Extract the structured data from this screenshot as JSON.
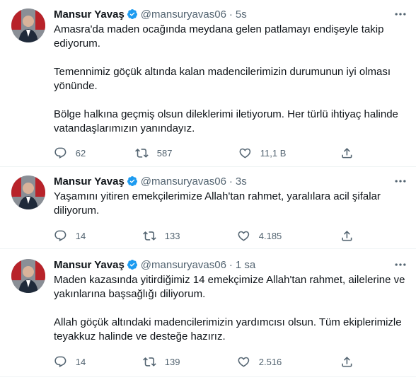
{
  "tweets": [
    {
      "name": "Mansur Yavaş",
      "handle": "@mansuryavas06",
      "dot": "·",
      "time": "5s",
      "paragraphs": [
        "Amasra'da maden ocağında meydana gelen patlamayı endişeyle takip ediyorum.",
        "Temennimiz göçük altında kalan madencilerimizin durumunun iyi olması yönünde.",
        "Bölge halkına geçmiş olsun dileklerimi iletiyorum. Her türlü ihtiyaç halinde vatandaşlarımızın yanındayız."
      ],
      "replies": "62",
      "retweets": "587",
      "likes": "11,1 B"
    },
    {
      "name": "Mansur Yavaş",
      "handle": "@mansuryavas06",
      "dot": "·",
      "time": "3s",
      "paragraphs": [
        "Yaşamını yitiren emekçilerimize Allah'tan rahmet, yaralılara acil şifalar diliyorum."
      ],
      "replies": "14",
      "retweets": "133",
      "likes": "4.185"
    },
    {
      "name": "Mansur Yavaş",
      "handle": "@mansuryavas06",
      "dot": "·",
      "time": "1 sa",
      "paragraphs": [
        "Maden kazasında yitirdiğimiz 14 emekçimize Allah'tan rahmet, ailelerine ve yakınlarına başsağlığı diliyorum.",
        "Allah göçük altındaki madencilerimizin yardımcısı olsun. Tüm ekiplerimizle teyakkuz halinde ve desteğe hazırız."
      ],
      "replies": "14",
      "retweets": "139",
      "likes": "2.516"
    }
  ],
  "icons": {
    "verified": "verified-badge-icon",
    "more": "more-options-icon",
    "reply": "reply-icon",
    "retweet": "retweet-icon",
    "like": "heart-icon",
    "share": "share-icon"
  },
  "colors": {
    "verified": "#1d9bf0",
    "text": "#0f1419",
    "muted": "#536471"
  }
}
